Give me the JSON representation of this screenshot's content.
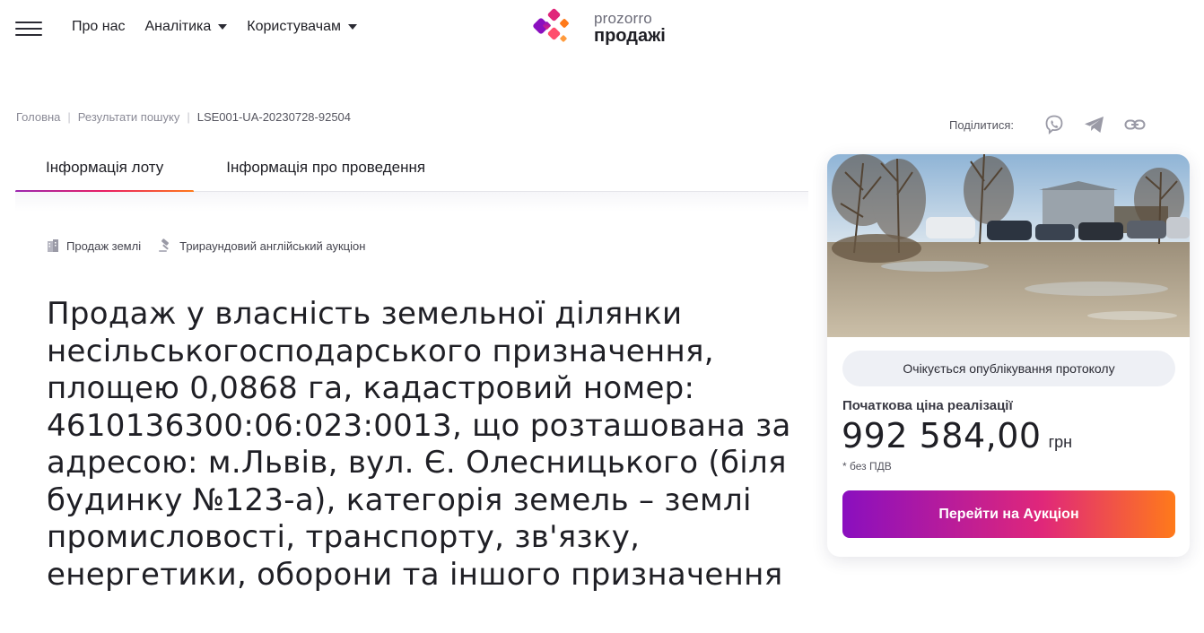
{
  "header": {
    "nav": [
      {
        "label": "Про нас",
        "has_dropdown": false
      },
      {
        "label": "Аналітика",
        "has_dropdown": true
      },
      {
        "label": "Користувачам",
        "has_dropdown": true
      }
    ],
    "logo": {
      "line1": "prozorro",
      "line2": "продажі"
    }
  },
  "breadcrumb": {
    "home": "Головна",
    "search": "Результати пошуку",
    "current": "LSE001-UA-20230728-92504"
  },
  "share": {
    "label": "Поділитися:",
    "icons": [
      "viber-icon",
      "telegram-icon",
      "link-icon"
    ]
  },
  "tabs": [
    {
      "label": "Інформація лоту",
      "active": true
    },
    {
      "label": "Інформація про проведення",
      "active": false
    }
  ],
  "tags": [
    {
      "icon": "building-icon",
      "label": "Продаж землі"
    },
    {
      "icon": "gavel-icon",
      "label": "Трираундовий англійський аукціон"
    }
  ],
  "lot": {
    "title": "Продаж у власність земельної ділянки несільськогосподарського призначення, площею 0,0868 га, кадастровий номер: 4610136300:06:023:0013, що розташована за адресою: м.Львів, вул. Є. Олесницького (біля будинку №123-а), категорія земель – землі промисловості, транспорту, зв'язку, енергетики, оборони та іншого призначення"
  },
  "card": {
    "status": "Очікується опублікування протоколу",
    "price_label": "Початкова ціна реалізації",
    "price_value": "992 584,00",
    "price_currency": "грн",
    "vat_note": "* без ПДВ",
    "cta_label": "Перейти на Аукціон"
  },
  "colors": {
    "accent_start": "#8a0fbf",
    "accent_mid": "#e0277a",
    "accent_end": "#ff7a1a"
  }
}
